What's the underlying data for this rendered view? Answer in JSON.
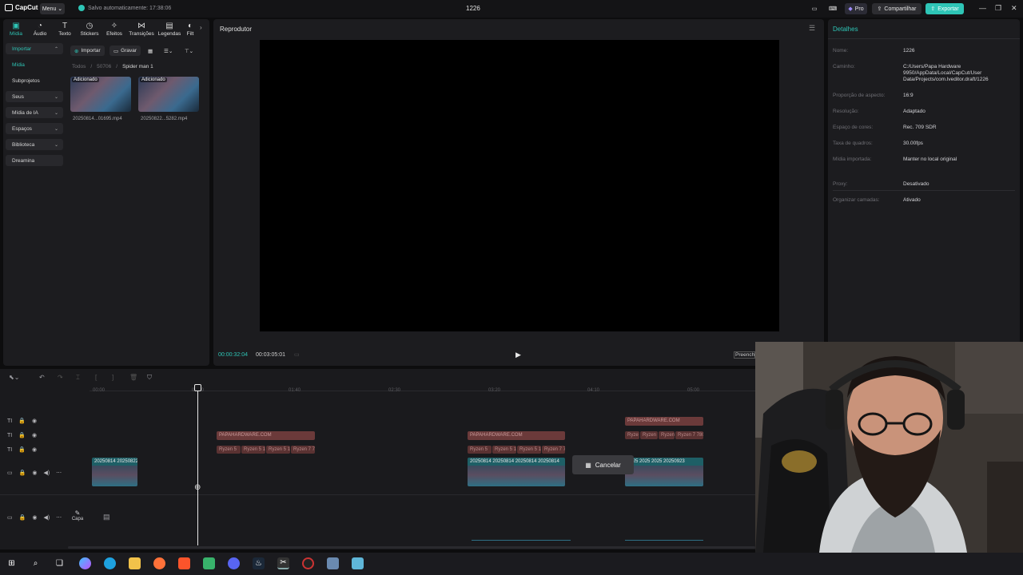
{
  "app": {
    "logo": "CapCut",
    "menu_label": "Menu",
    "saved_status": "Salvo automaticamente: 17:38:06",
    "project_title": "1226",
    "pro_label": "Pro",
    "share_label": "Compartilhar",
    "export_label": "Exportar",
    "accent": "#2ec5b6"
  },
  "toolbar": {
    "items": [
      {
        "label": "Mídia",
        "icon": "media-icon"
      },
      {
        "label": "Áudio",
        "icon": "audio-icon"
      },
      {
        "label": "Texto",
        "icon": "text-icon"
      },
      {
        "label": "Stickers",
        "icon": "sticker-icon"
      },
      {
        "label": "Efeitos",
        "icon": "effects-icon"
      },
      {
        "label": "Transições",
        "icon": "transitions-icon"
      },
      {
        "label": "Legendas",
        "icon": "captions-icon"
      },
      {
        "label": "Filt",
        "icon": "filters-icon"
      }
    ]
  },
  "sidebar": {
    "items": [
      {
        "label": "Importar"
      },
      {
        "label": "Mídia"
      },
      {
        "label": "Subprojetos"
      },
      {
        "label": "Seus"
      },
      {
        "label": "Mídia de IA"
      },
      {
        "label": "Espaços"
      },
      {
        "label": "Biblioteca"
      },
      {
        "label": "Dreamina"
      }
    ]
  },
  "media": {
    "import_label": "Importar",
    "record_label": "Gravar",
    "breadcrumb": [
      "Todos",
      "50706",
      "Spider man 1"
    ],
    "items": [
      {
        "tag": "Adicionado",
        "name": "20250814...01695.mp4"
      },
      {
        "tag": "Adicionado",
        "name": "20250822...5282.mp4"
      }
    ]
  },
  "player": {
    "title": "Reprodutor",
    "current_time": "00:00:32:04",
    "total_time": "00:03:05:01",
    "fill_label": "Preencher"
  },
  "details": {
    "title": "Detalhes",
    "rows": [
      {
        "label": "Nome:",
        "value": "1226"
      },
      {
        "label": "Caminho:",
        "value": "C:/Users/Papa Hardware 9950/AppData/Local/CapCut/User Data/Projects/com.lveditor.draft/1226"
      },
      {
        "label": "Proporção de aspecto:",
        "value": "16:9"
      },
      {
        "label": "Resolução:",
        "value": "Adaptado"
      },
      {
        "label": "Espaço de cores:",
        "value": "Rec. 709 SDR"
      },
      {
        "label": "Taxa de quadros:",
        "value": "30.00fps"
      },
      {
        "label": "Mídia importada:",
        "value": "Manter no local original"
      },
      {
        "label": "Proxy:",
        "value": "Desativado"
      },
      {
        "label": "Organizar camadas:",
        "value": "Ativado"
      }
    ]
  },
  "timeline": {
    "ruler": [
      "00:00",
      "00:10",
      "01:40",
      "02:30",
      "03:20",
      "04:10",
      "05:00"
    ],
    "text_clips": {
      "watermark": "PAPAHARDWARE.COM",
      "labels_a": [
        "Ryzen 5",
        "Ryzen 5 1",
        "Ryzen 5 1",
        "Ryzen 7 7"
      ],
      "labels_b": [
        "Ryzen 5",
        "Ryzen 5 1",
        "Ryzen 5 1",
        "Ryzen 7 7"
      ],
      "labels_c": [
        "Ryze",
        "Ryzen",
        "Ryzen 5",
        "Ryzen 7 780"
      ]
    },
    "video_clips": [
      {
        "label": "20250814 20250822"
      },
      {
        "label": "20250814 20250814 20250814 20250814"
      },
      {
        "label": "2025 2025 2025 20250923"
      }
    ],
    "cover_label": "Capa",
    "cancel_label": "Cancelar"
  }
}
